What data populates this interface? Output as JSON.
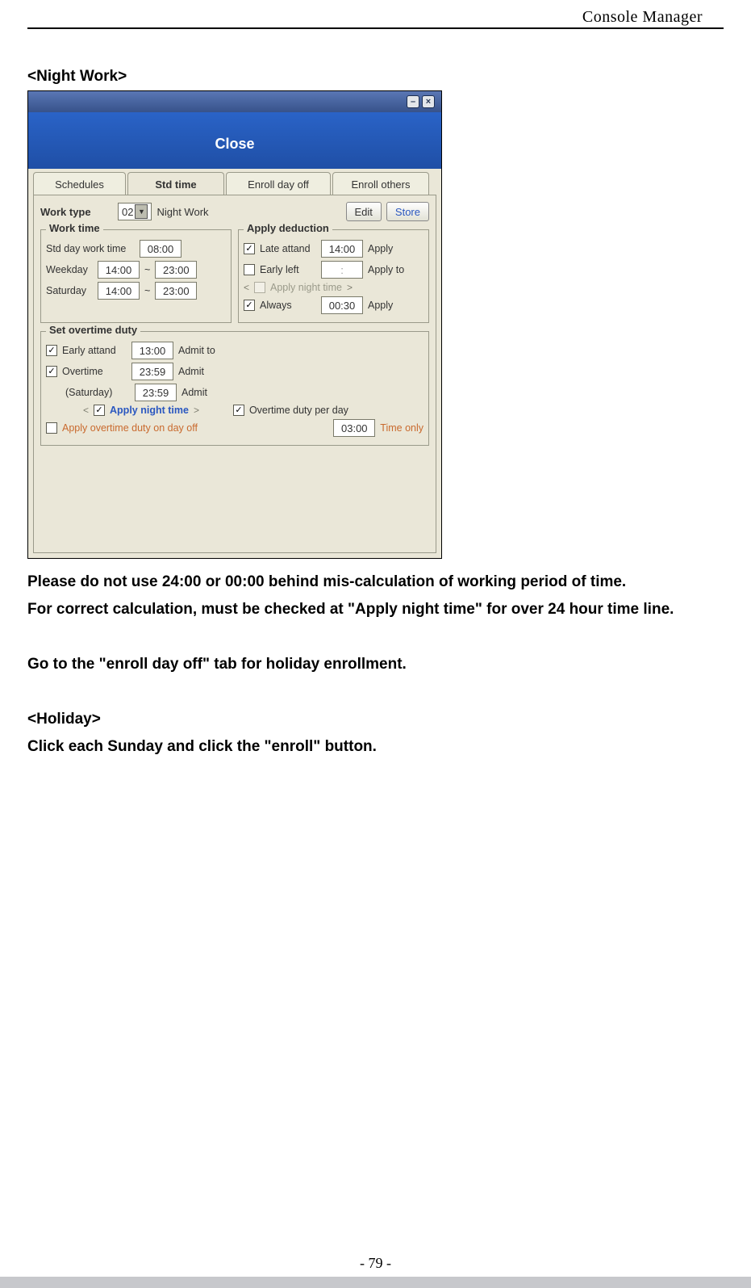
{
  "header": {
    "title": "Console Manager"
  },
  "section1_title": "<Night Work>",
  "screenshot": {
    "minimize": "–",
    "close_x": "×",
    "close_label": "Close",
    "tabs": [
      "Schedules",
      "Std time",
      "Enroll day off",
      "Enroll others"
    ],
    "work_type": {
      "label": "Work type",
      "value": "02",
      "name": "Night Work",
      "edit": "Edit",
      "store": "Store"
    },
    "work_time": {
      "legend": "Work time",
      "std_label": "Std day work time",
      "std_val": "08:00",
      "weekday_label": "Weekday",
      "weekday_from": "14:00",
      "tilde": "~",
      "weekday_to": "23:00",
      "saturday_label": "Saturday",
      "saturday_from": "14:00",
      "saturday_to": "23:00"
    },
    "apply_deduction": {
      "legend": "Apply deduction",
      "late_label": "Late attand",
      "late_val": "14:00",
      "apply": "Apply",
      "early_label": "Early left",
      "early_val": ":",
      "applyto": "Apply to",
      "night_label": "Apply night time",
      "always_label": "Always",
      "always_val": "00:30"
    },
    "overtime": {
      "legend": "Set overtime duty",
      "early_label": "Early attand",
      "early_val": "13:00",
      "admit_to": "Admit to",
      "ot_label": "Overtime",
      "ot_val": "23:59",
      "admit": "Admit",
      "sat_label": "(Saturday)",
      "sat_val": "23:59",
      "night_label": "Apply night time",
      "perday_label": "Overtime duty per day",
      "dayoff_label": "Apply overtime duty on day off",
      "perday_val": "03:00",
      "timeonly": "Time only"
    }
  },
  "body": {
    "p1": "Please do not use 24:00 or 00:00 behind mis-calculation of working period of time.",
    "p2": "For correct calculation, must be checked at \"Apply night time\" for over 24 hour time line.",
    "p3": "Go to the \"enroll day off\" tab for holiday enrollment.",
    "holiday_head": "<Holiday>",
    "p4": "Click each Sunday and click the \"enroll\" button."
  },
  "footer": {
    "page": "- 79 -"
  }
}
